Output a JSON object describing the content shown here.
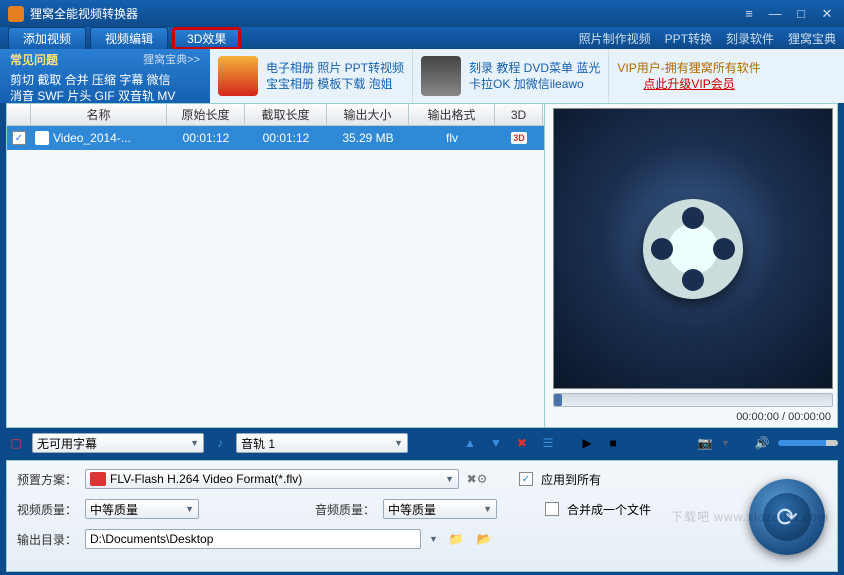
{
  "window": {
    "title": "狸窝全能视频转换器"
  },
  "toolbar": {
    "tabs": [
      "添加视频",
      "视频编辑",
      "3D效果"
    ],
    "rlinks": [
      "照片制作视频",
      "PPT转换",
      "刻录软件",
      "狸窝宝典"
    ]
  },
  "faq": {
    "title": "常见问题",
    "more": "狸窝宝典>>",
    "line1": "剪切 截取 合并 压缩 字幕 微信",
    "line2": "消音 SWF 片头 GIF 双音轨 MV"
  },
  "feat": {
    "a": {
      "l1": "电子相册 照片 PPT转视频",
      "l2": "宝宝相册 模板下载 泡姐"
    },
    "b": {
      "l1": "刻录 教程 DVD菜单 蓝光",
      "l2": "卡拉OK 加微信ileawo"
    },
    "vip": {
      "l1": "VIP用户-拥有狸窝所有软件",
      "l2": "点此升级VIP会员"
    }
  },
  "cols": {
    "name": "名称",
    "orig": "原始长度",
    "cut": "截取长度",
    "size": "输出大小",
    "fmt": "输出格式",
    "d3": "3D"
  },
  "row": {
    "name": "Video_2014-...",
    "orig": "00:01:12",
    "cut": "00:01:12",
    "size": "35.29 MB",
    "fmt": "flv"
  },
  "time": "00:00:00 / 00:00:00",
  "sub": {
    "subtitle": "无可用字幕",
    "audio": "音轨 1"
  },
  "form": {
    "preset_lbl": "预置方案：",
    "preset_val": "FLV-Flash H.264 Video Format(*.flv)",
    "vq_lbl": "视频质量：",
    "vq_val": "中等质量",
    "aq_lbl": "音频质量：",
    "aq_val": "中等质量",
    "out_lbl": "输出目录：",
    "out_val": "D:\\Documents\\Desktop",
    "applyall": "应用到所有",
    "merge": "合并成一个文件"
  },
  "watermark": "下载吧 www.xiazaiba.com"
}
